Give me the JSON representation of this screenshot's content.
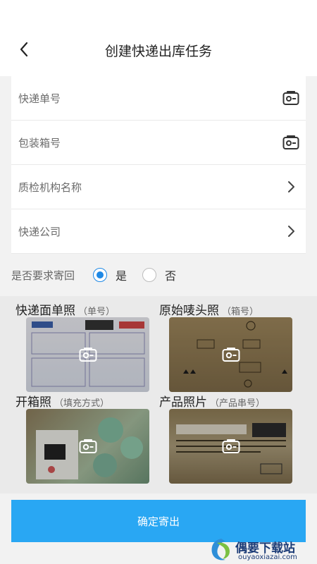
{
  "header": {
    "title": "创建快递出库任务"
  },
  "form": {
    "rows": [
      {
        "label": "快递单号",
        "icon": "scan-icon"
      },
      {
        "label": "包装箱号",
        "icon": "scan-icon"
      },
      {
        "label": "质检机构名称",
        "icon": "chevron-right-icon"
      },
      {
        "label": "快递公司",
        "icon": "chevron-right-icon"
      }
    ]
  },
  "ask": {
    "question": "是否要求寄回",
    "options": [
      {
        "label": "是",
        "selected": true
      },
      {
        "label": "否",
        "selected": false
      }
    ]
  },
  "photos": [
    {
      "title": "快递面单照",
      "sub": "（单号）"
    },
    {
      "title": "原始唛头照",
      "sub": "（箱号）"
    },
    {
      "title": "开箱照",
      "sub": "（填充方式）"
    },
    {
      "title": "产品照片",
      "sub": "（产品串号）"
    }
  ],
  "submit": {
    "label": "确定寄出"
  },
  "watermark": {
    "text": "偶要下载站",
    "url": "ouyaoxiazai.com"
  },
  "colors": {
    "accent": "#29a7f3",
    "radio": "#1e88e5",
    "background": "#f2f2f2"
  }
}
